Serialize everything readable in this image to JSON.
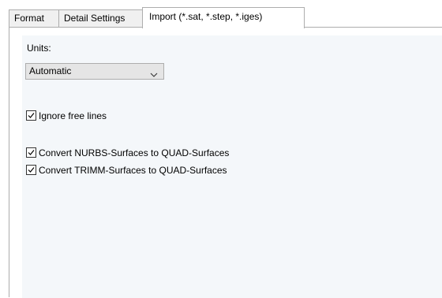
{
  "tabs": [
    {
      "label": "Format"
    },
    {
      "label": "Detail Settings"
    },
    {
      "label": "Import (*.sat, *.step, *.iges)"
    }
  ],
  "units": {
    "label": "Units:",
    "selected": "Automatic"
  },
  "options": [
    {
      "label": "Ignore free lines",
      "checked": true
    },
    {
      "label": "Convert NURBS-Surfaces to QUAD-Surfaces",
      "checked": true
    },
    {
      "label": "Convert TRIMM-Surfaces to QUAD-Surfaces",
      "checked": true
    }
  ],
  "icons": {
    "dropdown": "chevron-down-icon",
    "checkmark": "checkmark-icon"
  },
  "colors": {
    "panel_background": "#f4f7fa",
    "tab_background": "#f0f0f0",
    "dropdown_background": "#e5e5e5",
    "border": "#adadad"
  }
}
